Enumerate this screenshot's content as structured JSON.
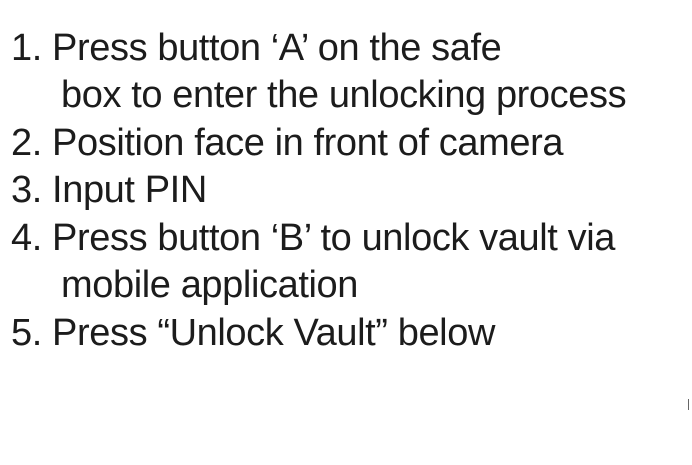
{
  "instructions": {
    "lines": [
      "1. Press button ‘A’  on the safe",
      "box to enter the unlocking process",
      "2. Position face in front of camera",
      "3. Input PIN",
      "4. Press button ‘B’ to unlock vault via",
      "mobile application",
      "5. Press “Unlock Vault” below"
    ]
  }
}
